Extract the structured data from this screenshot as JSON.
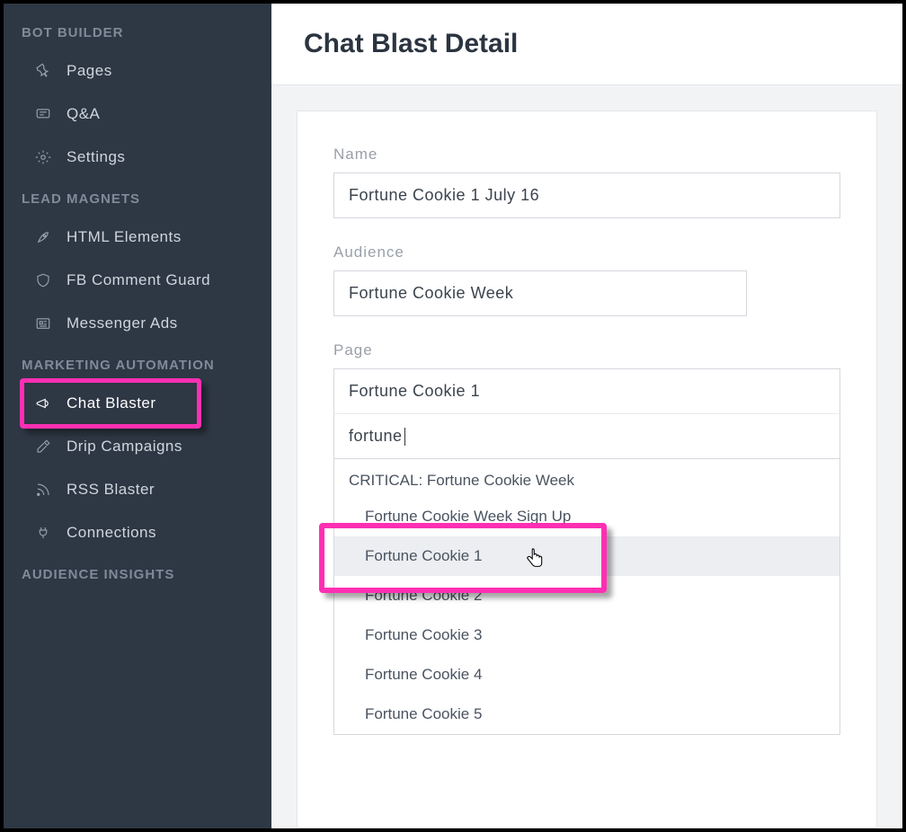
{
  "sidebar": {
    "sections": [
      {
        "title": "BOT BUILDER",
        "items": [
          {
            "label": "Pages",
            "icon": "pushpin-icon"
          },
          {
            "label": "Q&A",
            "icon": "chat-icon"
          },
          {
            "label": "Settings",
            "icon": "gear-icon"
          }
        ]
      },
      {
        "title": "LEAD MAGNETS",
        "items": [
          {
            "label": "HTML Elements",
            "icon": "rocket-icon"
          },
          {
            "label": "FB Comment Guard",
            "icon": "shield-icon"
          },
          {
            "label": "Messenger Ads",
            "icon": "newspaper-icon"
          }
        ]
      },
      {
        "title": "MARKETING AUTOMATION",
        "items": [
          {
            "label": "Chat Blaster",
            "icon": "megaphone-icon",
            "active": true,
            "highlight": true
          },
          {
            "label": "Drip Campaigns",
            "icon": "eyedropper-icon"
          },
          {
            "label": "RSS Blaster",
            "icon": "rss-icon"
          },
          {
            "label": "Connections",
            "icon": "plug-icon"
          }
        ]
      },
      {
        "title": "AUDIENCE INSIGHTS",
        "items": []
      }
    ]
  },
  "page": {
    "title": "Chat Blast Detail"
  },
  "form": {
    "name_label": "Name",
    "name_value": "Fortune Cookie 1 July 16",
    "audience_label": "Audience",
    "audience_value": "Fortune Cookie Week",
    "page_label": "Page",
    "page_selected": "Fortune Cookie 1",
    "page_search": "fortune",
    "dropdown": {
      "group": "CRITICAL: Fortune Cookie Week",
      "options": [
        "Fortune Cookie Week Sign Up",
        "Fortune Cookie 1",
        "Fortune Cookie 2",
        "Fortune Cookie 3",
        "Fortune Cookie 4",
        "Fortune Cookie 5"
      ],
      "hovered_index": 1,
      "highlight_index": 1
    }
  },
  "colors": {
    "highlight": "#ff2fb3"
  }
}
